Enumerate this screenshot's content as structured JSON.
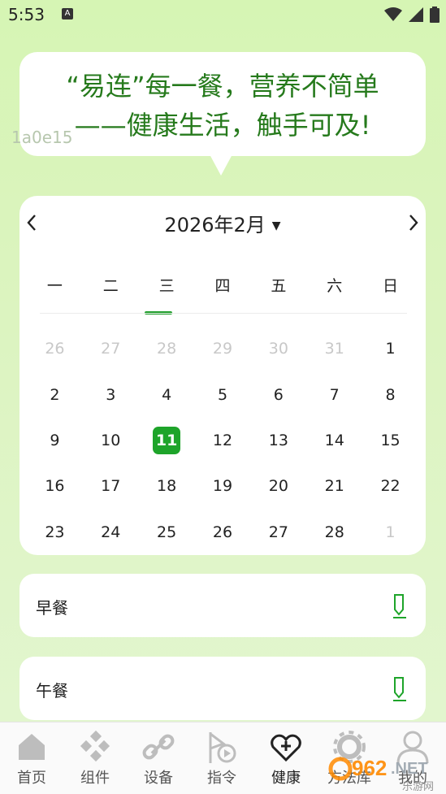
{
  "status": {
    "time": "5:53",
    "notification_glyph": "A"
  },
  "banner": {
    "line1": "“易连”每一餐，营养不简单",
    "line2": "——健康生活，触手可及!",
    "overlay_text": "1a0e15"
  },
  "calendar": {
    "title": "2026年2月",
    "weekdays": [
      "一",
      "二",
      "三",
      "四",
      "五",
      "六",
      "日"
    ],
    "selected_day": "11",
    "days": [
      {
        "d": "26",
        "muted": true
      },
      {
        "d": "27",
        "muted": true
      },
      {
        "d": "28",
        "muted": true
      },
      {
        "d": "29",
        "muted": true
      },
      {
        "d": "30",
        "muted": true
      },
      {
        "d": "31",
        "muted": true
      },
      {
        "d": "1",
        "muted": false
      },
      {
        "d": "2",
        "muted": false
      },
      {
        "d": "3",
        "muted": false
      },
      {
        "d": "4",
        "muted": false
      },
      {
        "d": "5",
        "muted": false
      },
      {
        "d": "6",
        "muted": false
      },
      {
        "d": "7",
        "muted": false
      },
      {
        "d": "8",
        "muted": false
      },
      {
        "d": "9",
        "muted": false
      },
      {
        "d": "10",
        "muted": false
      },
      {
        "d": "11",
        "muted": false
      },
      {
        "d": "12",
        "muted": false
      },
      {
        "d": "13",
        "muted": false
      },
      {
        "d": "14",
        "muted": false
      },
      {
        "d": "15",
        "muted": false
      },
      {
        "d": "16",
        "muted": false
      },
      {
        "d": "17",
        "muted": false
      },
      {
        "d": "18",
        "muted": false
      },
      {
        "d": "19",
        "muted": false
      },
      {
        "d": "20",
        "muted": false
      },
      {
        "d": "21",
        "muted": false
      },
      {
        "d": "22",
        "muted": false
      },
      {
        "d": "23",
        "muted": false
      },
      {
        "d": "24",
        "muted": false
      },
      {
        "d": "25",
        "muted": false
      },
      {
        "d": "26",
        "muted": false
      },
      {
        "d": "27",
        "muted": false
      },
      {
        "d": "28",
        "muted": false
      },
      {
        "d": "1",
        "muted": true
      }
    ]
  },
  "meals": {
    "breakfast": "早餐",
    "lunch": "午餐"
  },
  "tabs": [
    "首页",
    "组件",
    "设备",
    "指令",
    "健康",
    "方法库",
    "我的"
  ],
  "watermark": {
    "brand_digits": "962",
    "brand_net": ".NET",
    "brand_cn": "乐游网"
  },
  "colors": {
    "accent": "#1ea42a",
    "slogan": "#267a1c"
  }
}
